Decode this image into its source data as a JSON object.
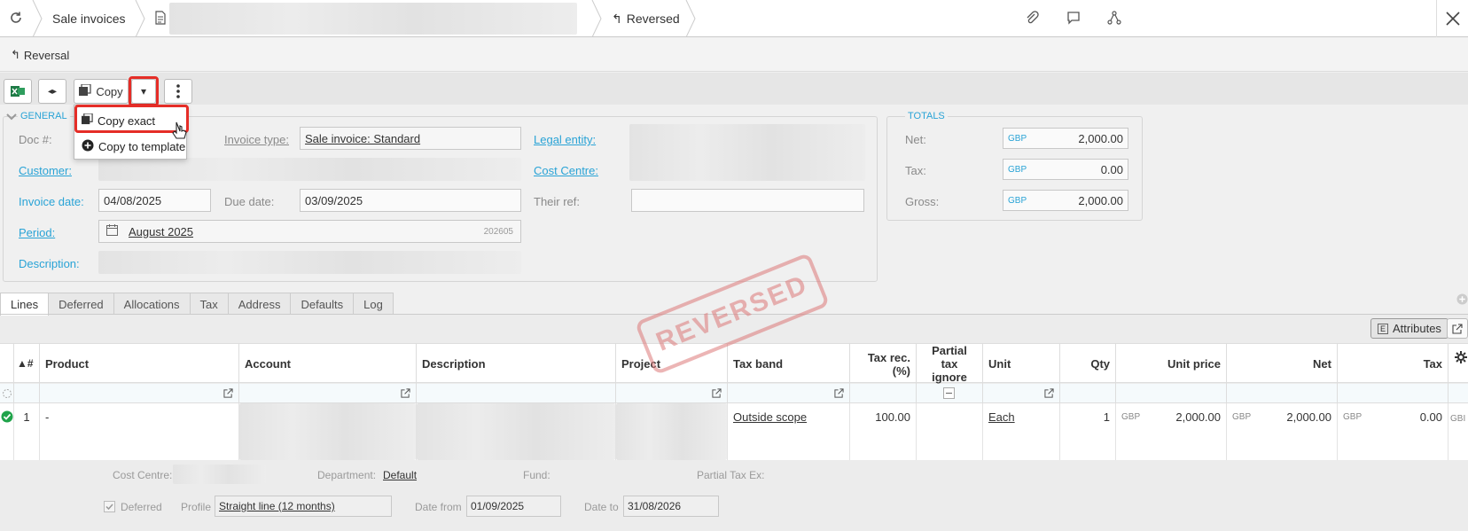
{
  "topbar": {
    "module": "Sale invoices",
    "status": "Reversed"
  },
  "reversal": {
    "label": "Reversal"
  },
  "toolbar": {
    "copy_label": "Copy",
    "dropdown_arrow": "▾"
  },
  "menu": {
    "copy_exact": "Copy exact",
    "copy_to_template": "Copy to template"
  },
  "general": {
    "legend": "GENERAL",
    "doc_label": "Doc #:",
    "invoice_type_label": "Invoice type:",
    "invoice_type_value": "Sale invoice: Standard",
    "legal_entity_label": "Legal entity:",
    "customer_label": "Customer:",
    "cost_centre_label": "Cost Centre:",
    "invoice_date_label": "Invoice date:",
    "invoice_date_value": "04/08/2025",
    "due_date_label": "Due date:",
    "due_date_value": "03/09/2025",
    "their_ref_label": "Their ref:",
    "their_ref_value": "",
    "period_label": "Period:",
    "period_value": "August 2025",
    "period_code": "202605",
    "description_label": "Description:"
  },
  "totals": {
    "legend": "TOTALS",
    "rows": [
      {
        "label": "Net:",
        "currency": "GBP",
        "value": "2,000.00"
      },
      {
        "label": "Tax:",
        "currency": "GBP",
        "value": "0.00"
      },
      {
        "label": "Gross:",
        "currency": "GBP",
        "value": "2,000.00"
      }
    ]
  },
  "tabs": [
    "Lines",
    "Deferred",
    "Allocations",
    "Tax",
    "Address",
    "Defaults",
    "Log"
  ],
  "stamp_text": "REVERSED",
  "attributes_label": "Attributes",
  "grid": {
    "columns": {
      "num": "▲#",
      "product": "Product",
      "account": "Account",
      "description": "Description",
      "project": "Project",
      "tax_band": "Tax band",
      "tax_rec": "Tax rec. (%)",
      "partial_tax": "Partial tax ignore",
      "unit": "Unit",
      "qty": "Qty",
      "unit_price": "Unit price",
      "net": "Net",
      "tax": "Tax"
    },
    "row": {
      "num": "1",
      "product": "-",
      "tax_band": "Outside scope",
      "tax_rec": "100.00",
      "unit": "Each",
      "qty": "1",
      "unit_price_cur": "GBP",
      "unit_price": "2,000.00",
      "net_cur": "GBP",
      "net": "2,000.00",
      "tax_cur": "GBP",
      "tax": "0.00",
      "extra_cur": "GBI"
    }
  },
  "detail": {
    "cost_centre_label": "Cost Centre:",
    "department_label": "Department:",
    "department_value": "Default",
    "fund_label": "Fund:",
    "partial_tax_label": "Partial Tax Ex:",
    "deferred_label": "Deferred",
    "profile_label": "Profile",
    "profile_value": "Straight line (12 months)",
    "date_from_label": "Date from",
    "date_from_value": "01/09/2025",
    "date_to_label": "Date to",
    "date_to_value": "31/08/2026"
  },
  "colors": {
    "accent": "#29a3d6",
    "highlight": "#e52d27",
    "stamp": "#dd7878",
    "excel_green": "#1d7a45"
  }
}
